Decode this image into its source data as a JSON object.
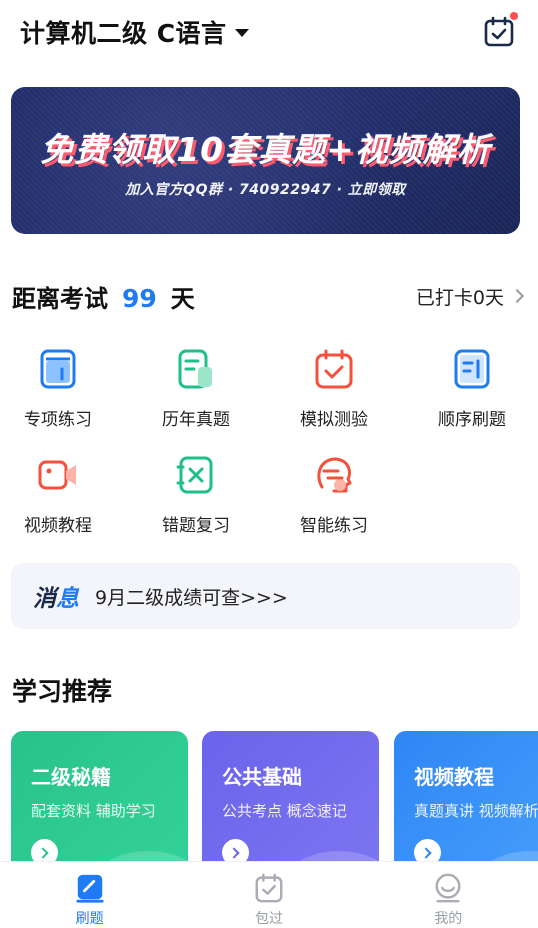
{
  "header": {
    "subject": "计算机二级 C语言"
  },
  "banner": {
    "title": "免费领取10套真题+视频解析",
    "subtitle": "加入官方QQ群 · 740922947 · 立即领取"
  },
  "countdown": {
    "prefix": "距离考试",
    "days": "99",
    "suffix": "天",
    "checkin": "已打卡0天"
  },
  "features": [
    {
      "label": "专项练习",
      "icon": "book-icon",
      "color": "#1e7bf3"
    },
    {
      "label": "历年真题",
      "icon": "paper-icon",
      "color": "#1fbf8a"
    },
    {
      "label": "模拟测验",
      "icon": "calendar-check-icon",
      "color": "#f5503b"
    },
    {
      "label": "顺序刷题",
      "icon": "list-icon",
      "color": "#1e7bf3"
    },
    {
      "label": "视频教程",
      "icon": "video-icon",
      "color": "#f5503b"
    },
    {
      "label": "错题复习",
      "icon": "wrong-icon",
      "color": "#1fbf8a"
    },
    {
      "label": "智能练习",
      "icon": "ai-head-icon",
      "color": "#f5503b"
    }
  ],
  "notice": {
    "tag_a": "消",
    "tag_b": "息",
    "text": "9月二级成绩可查>>>"
  },
  "recommend": {
    "title": "学习推荐",
    "cards": [
      {
        "title": "二级秘籍",
        "subtitle": "配套资料 辅助学习"
      },
      {
        "title": "公共基础",
        "subtitle": "公共考点 概念速记"
      },
      {
        "title": "视频教程",
        "subtitle": "真题真讲 视频解析"
      }
    ]
  },
  "tabs": [
    {
      "label": "刷题",
      "active": true
    },
    {
      "label": "包过",
      "active": false
    },
    {
      "label": "我的",
      "active": false
    }
  ]
}
